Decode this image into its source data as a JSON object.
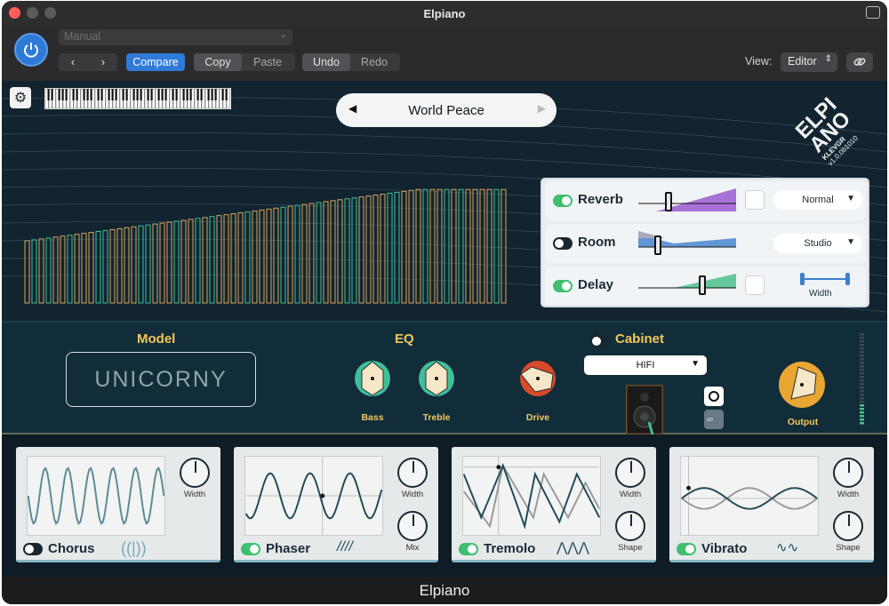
{
  "window": {
    "title": "Elpiano"
  },
  "toolbar": {
    "preset": "Manual",
    "compare": "Compare",
    "copy": "Copy",
    "paste": "Paste",
    "undo": "Undo",
    "redo": "Redo",
    "view_label": "View:",
    "view_value": "Editor"
  },
  "plugin": {
    "preset_name": "World Peace",
    "logo": {
      "line1": "ELPI",
      "line2": "ANO",
      "brand": "KLEVGR",
      "version": "v1.0.0b1010"
    },
    "effects": [
      {
        "name": "Reverb",
        "on": true,
        "level": 0.11,
        "mode": "Normal",
        "color": "#9b59d0"
      },
      {
        "name": "Room",
        "on": false,
        "level": 0.12,
        "mode": "Studio",
        "color": "#3e7fd0"
      },
      {
        "name": "Delay",
        "on": true,
        "level": 0.68,
        "mode": "Width",
        "color": "#4cc08a"
      }
    ],
    "sections": {
      "model": "Model",
      "model_value": "UNICORNY",
      "eq": "EQ",
      "bass": "Bass",
      "treble": "Treble",
      "drive": "Drive",
      "cabinet": "Cabinet",
      "cabinet_value": "HIFI",
      "output": "Output"
    },
    "modules": [
      {
        "name": "Chorus",
        "on": false,
        "knobs": [
          "Width"
        ]
      },
      {
        "name": "Phaser",
        "on": true,
        "knobs": [
          "Width",
          "Mix"
        ]
      },
      {
        "name": "Tremolo",
        "on": true,
        "knobs": [
          "Width",
          "Shape"
        ]
      },
      {
        "name": "Vibrato",
        "on": true,
        "knobs": [
          "Width",
          "Shape"
        ]
      }
    ],
    "footer": "Elpiano"
  },
  "colors": {
    "accent": "#2f7ad8",
    "gold": "#f3c75a",
    "panel": "#112430"
  }
}
